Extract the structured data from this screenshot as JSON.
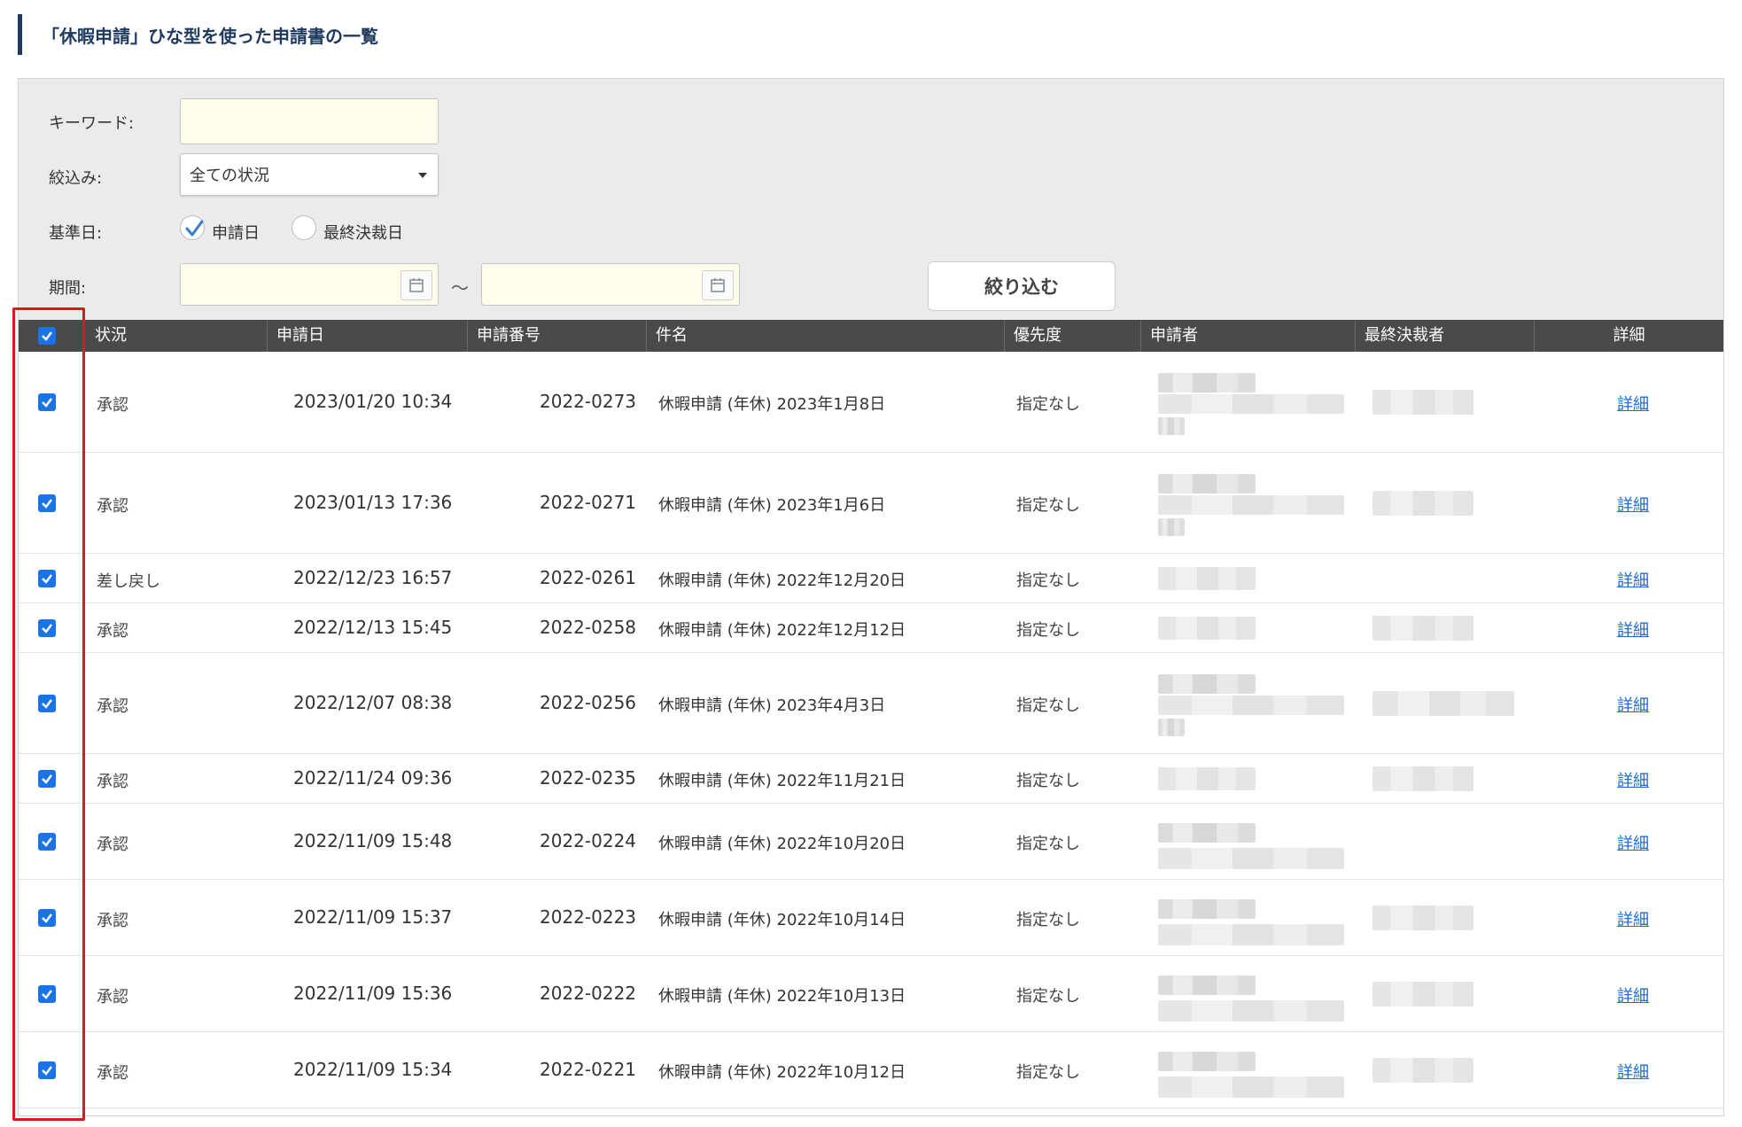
{
  "header": {
    "title": "「休暇申請」ひな型を使った申請書の一覧"
  },
  "filters": {
    "keyword_label": "キーワード:",
    "keyword_value": "",
    "narrow_label": "絞込み:",
    "narrow_selected": "全ての状況",
    "base_date_label": "基準日:",
    "base_date_options": [
      {
        "label": "申請日",
        "checked": true
      },
      {
        "label": "最終決裁日",
        "checked": false
      }
    ],
    "period_label": "期間:",
    "period_from": "",
    "period_to": "",
    "period_separator": "〜",
    "submit_label": "絞り込む"
  },
  "table": {
    "columns": [
      "状況",
      "申請日",
      "申請番号",
      "件名",
      "優先度",
      "申請者",
      "最終決裁者",
      "詳細"
    ],
    "select_all_checked": true,
    "rows": [
      {
        "checked": true,
        "status": "承認",
        "date": "2023/01/20 10:34",
        "number": "2022-0273",
        "subject": "休暇申請 (年休) 2023年1月8日",
        "priority": "指定なし",
        "detail": "詳細"
      },
      {
        "checked": true,
        "status": "承認",
        "date": "2023/01/13 17:36",
        "number": "2022-0271",
        "subject": "休暇申請 (年休) 2023年1月6日",
        "priority": "指定なし",
        "detail": "詳細"
      },
      {
        "checked": true,
        "status": "差し戻し",
        "date": "2022/12/23 16:57",
        "number": "2022-0261",
        "subject": "休暇申請 (年休) 2022年12月20日",
        "priority": "指定なし",
        "detail": "詳細"
      },
      {
        "checked": true,
        "status": "承認",
        "date": "2022/12/13 15:45",
        "number": "2022-0258",
        "subject": "休暇申請 (年休) 2022年12月12日",
        "priority": "指定なし",
        "detail": "詳細"
      },
      {
        "checked": true,
        "status": "承認",
        "date": "2022/12/07 08:38",
        "number": "2022-0256",
        "subject": "休暇申請 (年休) 2023年4月3日",
        "priority": "指定なし",
        "detail": "詳細"
      },
      {
        "checked": true,
        "status": "承認",
        "date": "2022/11/24 09:36",
        "number": "2022-0235",
        "subject": "休暇申請 (年休) 2022年11月21日",
        "priority": "指定なし",
        "detail": "詳細"
      },
      {
        "checked": true,
        "status": "承認",
        "date": "2022/11/09 15:48",
        "number": "2022-0224",
        "subject": "休暇申請 (年休) 2022年10月20日",
        "priority": "指定なし",
        "detail": "詳細"
      },
      {
        "checked": true,
        "status": "承認",
        "date": "2022/11/09 15:37",
        "number": "2022-0223",
        "subject": "休暇申請 (年休) 2022年10月14日",
        "priority": "指定なし",
        "detail": "詳細"
      },
      {
        "checked": true,
        "status": "承認",
        "date": "2022/11/09 15:36",
        "number": "2022-0222",
        "subject": "休暇申請 (年休) 2022年10月13日",
        "priority": "指定なし",
        "detail": "詳細"
      },
      {
        "checked": true,
        "status": "承認",
        "date": "2022/11/09 15:34",
        "number": "2022-0221",
        "subject": "休暇申請 (年休) 2022年10月12日",
        "priority": "指定なし",
        "detail": "詳細"
      }
    ]
  },
  "colors": {
    "header_accent": "#1e3a5f",
    "table_head": "#4a4a4a",
    "checkbox": "#1a73e8",
    "link": "#1a6cd6",
    "highlight_frame": "#e0161b",
    "input_bg": "#fefde9"
  }
}
